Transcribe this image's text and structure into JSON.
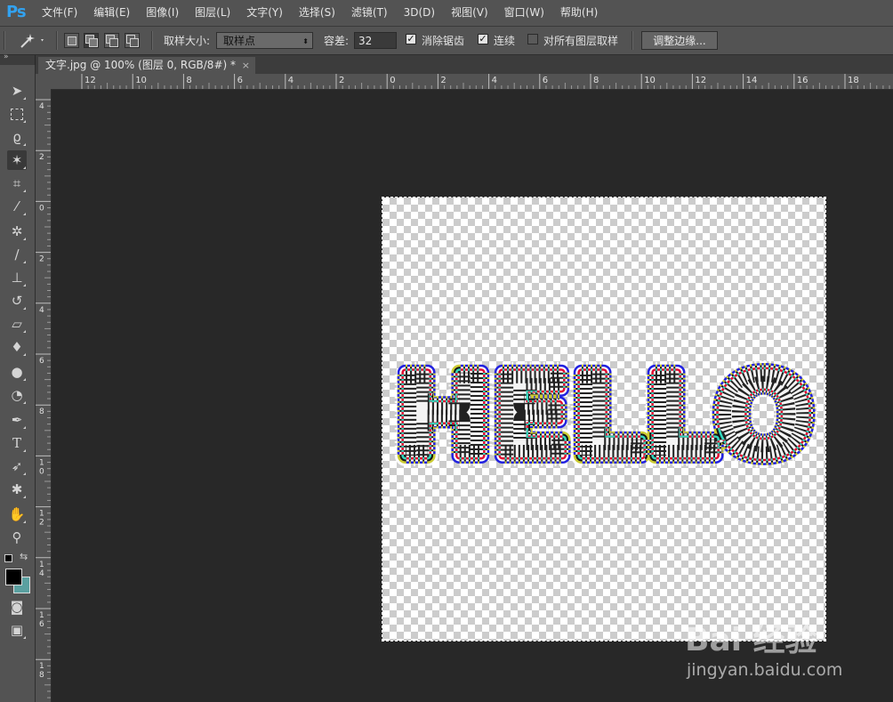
{
  "app": {
    "logo": "Ps"
  },
  "menu": [
    "文件(F)",
    "编辑(E)",
    "图像(I)",
    "图层(L)",
    "文字(Y)",
    "选择(S)",
    "滤镜(T)",
    "3D(D)",
    "视图(V)",
    "窗口(W)",
    "帮助(H)"
  ],
  "options": {
    "sample_size_label": "取样大小:",
    "sample_size_value": "取样点",
    "tolerance_label": "容差:",
    "tolerance_value": "32",
    "anti_alias_label": "消除锯齿",
    "anti_alias_checked": true,
    "contiguous_label": "连续",
    "contiguous_checked": true,
    "sample_all_layers_label": "对所有图层取样",
    "sample_all_layers_checked": false,
    "refine_edge_label": "调整边缘..."
  },
  "document": {
    "tab_title": "文字.jpg @ 100% (图层 0, RGB/8#) *",
    "close_glyph": "×",
    "text": "HELLO"
  },
  "rulers": {
    "top_labels": [
      "12",
      "10",
      "8",
      "6",
      "4",
      "2",
      "0",
      "2",
      "4",
      "6",
      "8",
      "10",
      "12",
      "14",
      "16",
      "18"
    ],
    "left_labels": [
      "4",
      "2",
      "0",
      "2",
      "4",
      "6",
      "8",
      "1 0",
      "1 2",
      "1 4",
      "1 6",
      "1 8"
    ]
  },
  "tools": [
    "move-tool",
    "marquee-tool",
    "lasso-tool",
    "magic-wand-tool",
    "crop-tool",
    "eyedropper-tool",
    "healing-brush-tool",
    "brush-tool",
    "clone-stamp-tool",
    "history-brush-tool",
    "eraser-tool",
    "paint-bucket-tool",
    "blur-tool",
    "dodge-tool",
    "pen-tool",
    "type-tool",
    "path-selection-tool",
    "custom-shape-tool",
    "hand-tool",
    "zoom-tool"
  ],
  "colors": {
    "foreground": "#000000",
    "background": "#5aa0a0",
    "accent": "#32a2f0",
    "letter_stroke_outer": "#2020e0",
    "letter_stroke_inner": "#e01030",
    "letter_fill": "#f4f4f4"
  },
  "watermark": {
    "brand": "Bai 经验",
    "url": "jingyan.baidu.com"
  }
}
